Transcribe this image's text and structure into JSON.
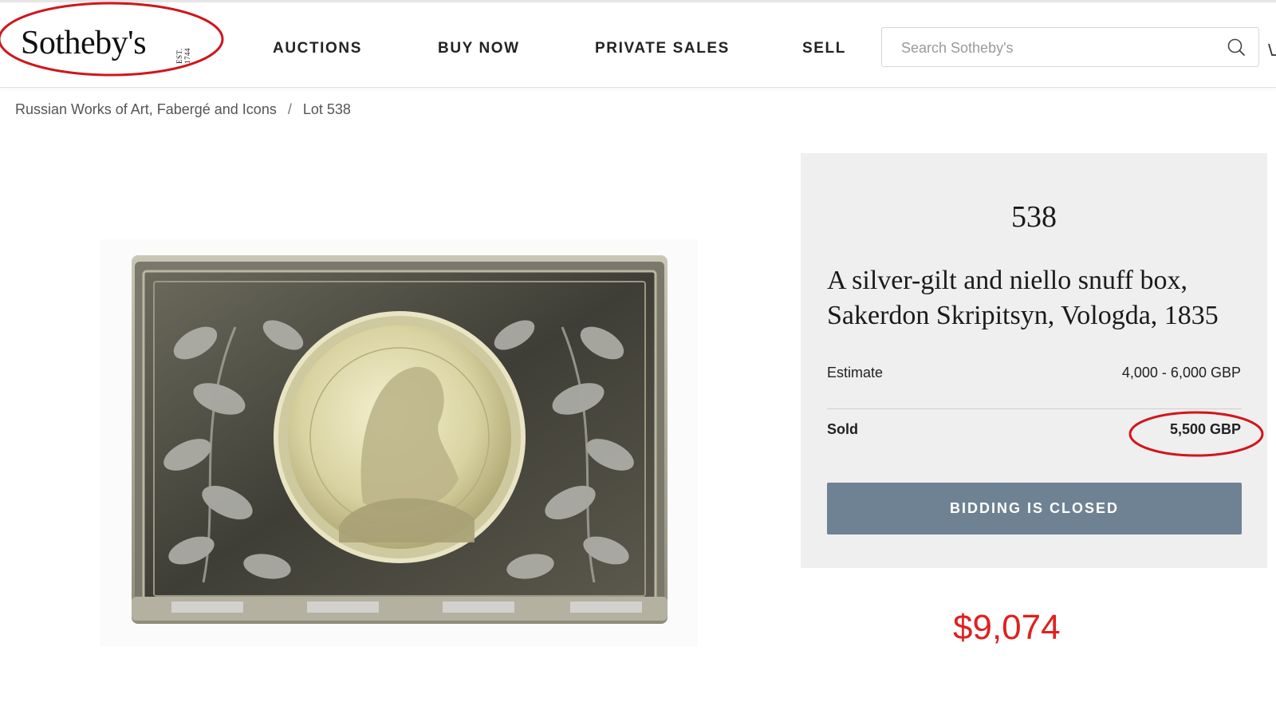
{
  "header": {
    "logo_text": "Sotheby's",
    "logo_est": "EST. 1744",
    "nav": [
      "AUCTIONS",
      "BUY NOW",
      "PRIVATE SALES",
      "SELL"
    ],
    "search_placeholder": "Search Sotheby's"
  },
  "breadcrumb": {
    "sale": "Russian Works of Art, Fabergé and Icons",
    "separator": "/",
    "lot": "Lot 538"
  },
  "lot": {
    "number": "538",
    "title": "A silver-gilt and niello snuff box, Sakerdon Skripitsyn, Vologda, 1835",
    "estimate_label": "Estimate",
    "estimate_value": "4,000 - 6,000 GBP",
    "sold_label": "Sold",
    "sold_value": "5,500 GBP",
    "bidding_button": "BIDDING IS CLOSED"
  },
  "annotation": {
    "converted_price": "$9,074",
    "highlight_color": "#d0161c"
  },
  "colors": {
    "panel_bg": "#efefef",
    "button_bg": "#6e8293",
    "converted_price": "#e02020"
  }
}
